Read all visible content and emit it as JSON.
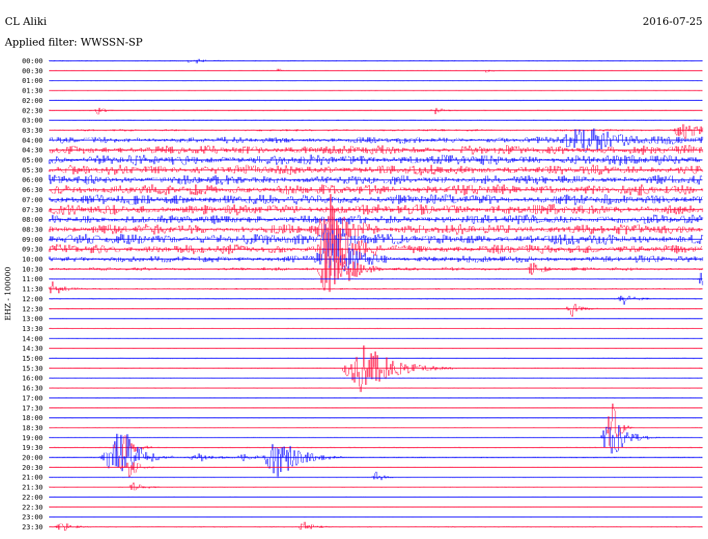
{
  "header": {
    "station": "CL Aliki",
    "date": "2016-07-25",
    "filter": "Applied filter: WWSSN-SP"
  },
  "chart_data": {
    "type": "line",
    "chart_kind": "helicorder",
    "ylabel": "EHZ - 100000",
    "trace_colors": [
      "#0000ff",
      "#ff0033"
    ],
    "time_labels": [
      "00:00",
      "00:30",
      "01:00",
      "01:30",
      "02:00",
      "02:30",
      "03:00",
      "03:30",
      "04:00",
      "04:30",
      "05:00",
      "05:30",
      "06:00",
      "06:30",
      "07:00",
      "07:30",
      "08:00",
      "08:30",
      "09:00",
      "09:30",
      "10:00",
      "10:30",
      "11:00",
      "11:30",
      "12:00",
      "12:30",
      "13:00",
      "13:30",
      "14:00",
      "14:30",
      "15:00",
      "15:30",
      "16:00",
      "16:30",
      "17:00",
      "17:30",
      "18:00",
      "18:30",
      "19:00",
      "19:30",
      "20:00",
      "20:30",
      "21:00",
      "21:30",
      "22:00",
      "22:30",
      "23:00",
      "23:30"
    ],
    "row_activity": [
      0.06,
      0.05,
      0.05,
      0.05,
      0.05,
      0.06,
      0.06,
      0.2,
      0.55,
      0.8,
      0.9,
      0.85,
      0.8,
      0.9,
      0.9,
      0.9,
      0.8,
      0.85,
      0.9,
      0.8,
      0.6,
      0.3,
      0.06,
      0.08,
      0.06,
      0.06,
      0.05,
      0.05,
      0.05,
      0.05,
      0.05,
      0.06,
      0.05,
      0.05,
      0.05,
      0.05,
      0.05,
      0.05,
      0.05,
      0.06,
      0.07,
      0.05,
      0.05,
      0.05,
      0.04,
      0.04,
      0.04,
      0.06
    ],
    "events": [
      {
        "row": 0,
        "pos": 0.22,
        "amp": 0.35,
        "width": 0.012
      },
      {
        "row": 1,
        "pos": 0.35,
        "amp": 0.25,
        "width": 0.004
      },
      {
        "row": 1,
        "pos": 0.67,
        "amp": 0.25,
        "width": 0.004
      },
      {
        "row": 5,
        "pos": 0.075,
        "amp": 0.5,
        "width": 0.006
      },
      {
        "row": 5,
        "pos": 0.59,
        "amp": 0.35,
        "width": 0.01
      },
      {
        "row": 7,
        "pos": 0.97,
        "amp": 1.1,
        "width": 0.02
      },
      {
        "row": 8,
        "pos": 0.82,
        "amp": 1.3,
        "width": 0.05
      },
      {
        "row": 17,
        "pos": 0.43,
        "amp": 3.5,
        "width": 0.02
      },
      {
        "row": 18,
        "pos": 0.43,
        "amp": 2.2,
        "width": 0.02
      },
      {
        "row": 19,
        "pos": 0.43,
        "amp": 5.0,
        "width": 0.02
      },
      {
        "row": 20,
        "pos": 0.43,
        "amp": 3.0,
        "width": 0.025
      },
      {
        "row": 21,
        "pos": 0.43,
        "amp": 4.5,
        "width": 0.02
      },
      {
        "row": 21,
        "pos": 0.74,
        "amp": 0.8,
        "width": 0.01
      },
      {
        "row": 22,
        "pos": 0.998,
        "amp": 0.9,
        "width": 0.006
      },
      {
        "row": 23,
        "pos": 0.005,
        "amp": 0.8,
        "width": 0.012
      },
      {
        "row": 24,
        "pos": 0.88,
        "amp": 0.6,
        "width": 0.012
      },
      {
        "row": 25,
        "pos": 0.8,
        "amp": 0.8,
        "width": 0.01
      },
      {
        "row": 31,
        "pos": 0.48,
        "amp": 2.8,
        "width": 0.035
      },
      {
        "row": 37,
        "pos": 0.86,
        "amp": 3.5,
        "width": 0.008
      },
      {
        "row": 38,
        "pos": 0.86,
        "amp": 2.4,
        "width": 0.018
      },
      {
        "row": 39,
        "pos": 0.11,
        "amp": 2.4,
        "width": 0.012
      },
      {
        "row": 40,
        "pos": 0.11,
        "amp": 3.5,
        "width": 0.02
      },
      {
        "row": 40,
        "pos": 0.09,
        "amp": 1.0,
        "width": 0.015
      },
      {
        "row": 40,
        "pos": 0.23,
        "amp": 0.5,
        "width": 0.02
      },
      {
        "row": 40,
        "pos": 0.3,
        "amp": 0.4,
        "width": 0.015
      },
      {
        "row": 40,
        "pos": 0.35,
        "amp": 2.4,
        "width": 0.025
      },
      {
        "row": 41,
        "pos": 0.12,
        "amp": 1.5,
        "width": 0.01
      },
      {
        "row": 42,
        "pos": 0.5,
        "amp": 0.6,
        "width": 0.008
      },
      {
        "row": 43,
        "pos": 0.13,
        "amp": 0.6,
        "width": 0.01
      },
      {
        "row": 47,
        "pos": 0.02,
        "amp": 0.5,
        "width": 0.012
      },
      {
        "row": 47,
        "pos": 0.39,
        "amp": 0.5,
        "width": 0.012
      }
    ]
  }
}
